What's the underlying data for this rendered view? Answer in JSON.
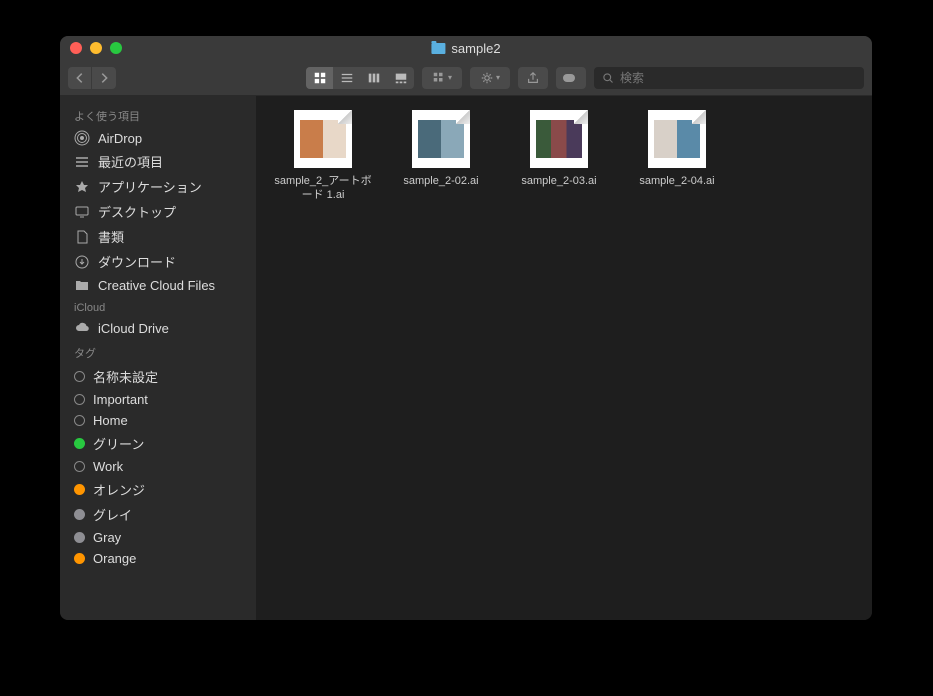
{
  "title": "sample2",
  "toolbar": {
    "search_placeholder": "検索"
  },
  "sidebar": {
    "favorites_header": "よく使う項目",
    "favorites": [
      {
        "icon": "airdrop",
        "label": "AirDrop"
      },
      {
        "icon": "recent",
        "label": "最近の項目"
      },
      {
        "icon": "apps",
        "label": "アプリケーション"
      },
      {
        "icon": "desktop",
        "label": "デスクトップ"
      },
      {
        "icon": "documents",
        "label": "書類"
      },
      {
        "icon": "downloads",
        "label": "ダウンロード"
      },
      {
        "icon": "folder",
        "label": "Creative Cloud Files"
      }
    ],
    "icloud_header": "iCloud",
    "icloud": [
      {
        "icon": "cloud",
        "label": "iCloud Drive"
      }
    ],
    "tags_header": "タグ",
    "tags": [
      {
        "color": "",
        "label": "名称未設定"
      },
      {
        "color": "",
        "label": "Important"
      },
      {
        "color": "",
        "label": "Home"
      },
      {
        "color": "#28c840",
        "label": "グリーン"
      },
      {
        "color": "",
        "label": "Work"
      },
      {
        "color": "#ff9500",
        "label": "オレンジ"
      },
      {
        "color": "#8e8e93",
        "label": "グレイ"
      },
      {
        "color": "#8e8e93",
        "label": "Gray"
      },
      {
        "color": "#ff9500",
        "label": "Orange"
      }
    ]
  },
  "files": [
    {
      "name": "sample_2_アートボード 1.ai",
      "thumb_colors": [
        "#c97d4a",
        "#e8d8c8"
      ]
    },
    {
      "name": "sample_2-02.ai",
      "thumb_colors": [
        "#4a6a7a",
        "#8aa8b8"
      ]
    },
    {
      "name": "sample_2-03.ai",
      "thumb_colors": [
        "#3a5a3a",
        "#8a4a4a",
        "#4a3a5a"
      ]
    },
    {
      "name": "sample_2-04.ai",
      "thumb_colors": [
        "#d8d0c8",
        "#5a8aa8"
      ]
    }
  ]
}
